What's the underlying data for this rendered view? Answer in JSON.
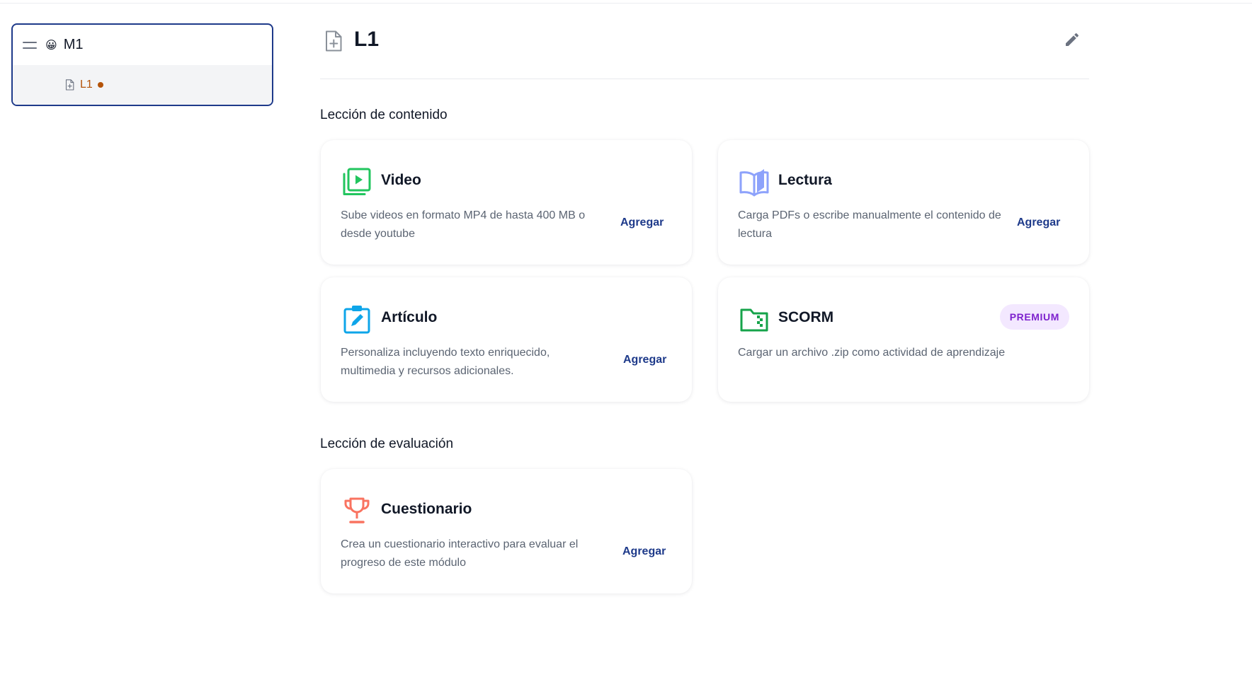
{
  "sidebar": {
    "module": {
      "emoji": "😀",
      "title": "M1"
    },
    "lesson": {
      "label": "L1",
      "status_color": "#b45309"
    }
  },
  "header": {
    "title": "L1"
  },
  "sections": {
    "content": {
      "title": "Lección de contenido"
    },
    "evaluation": {
      "title": "Lección de evaluación"
    }
  },
  "cards": {
    "video": {
      "title": "Video",
      "description": "Sube videos en formato MP4 de hasta 400 MB o desde youtube",
      "action": "Agregar",
      "icon": "video-icon",
      "icon_color": "#22c55e"
    },
    "reading": {
      "title": "Lectura",
      "description": "Carga PDFs o escribe manualmente el contenido de lectura",
      "action": "Agregar",
      "icon": "book-icon",
      "icon_color": "#8da2fb"
    },
    "article": {
      "title": "Artículo",
      "description": "Personaliza incluyendo texto enriquecido, multimedia y recursos adicionales.",
      "action": "Agregar",
      "icon": "clipboard-edit-icon",
      "icon_color": "#0ea5e9"
    },
    "scorm": {
      "title": "SCORM",
      "description": "Cargar un archivo .zip como actividad de aprendizaje",
      "badge": "PREMIUM",
      "icon": "zip-folder-icon",
      "icon_color": "#16a34a"
    },
    "quiz": {
      "title": "Cuestionario",
      "description": "Crea un cuestionario interactivo para evaluar el progreso de este módulo",
      "action": "Agregar",
      "icon": "trophy-icon",
      "icon_color": "#f97360"
    }
  },
  "colors": {
    "accent": "#1e3a8a",
    "premium_bg": "#f3e8ff",
    "premium_text": "#7e22ce"
  }
}
